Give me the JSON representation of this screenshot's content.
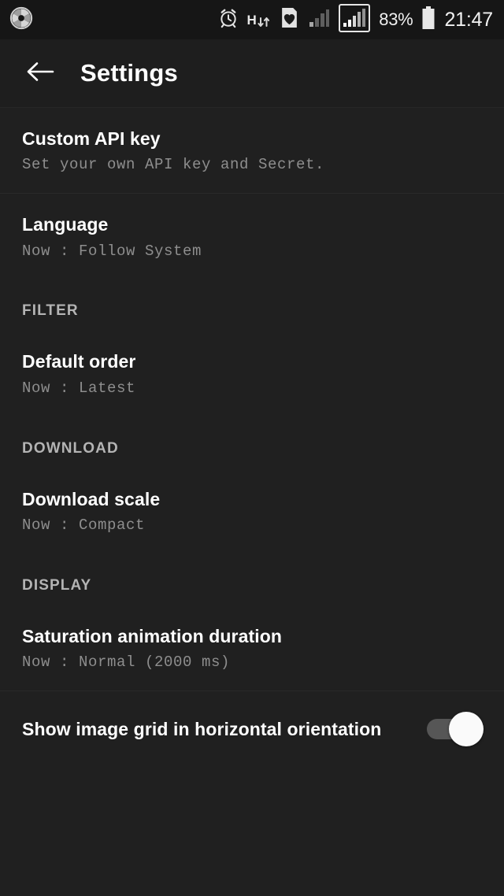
{
  "status_bar": {
    "app_icon": "camera-aperture-icon",
    "icons": [
      "alarm-clock-icon",
      "hspa-data-icon",
      "heart-card-icon",
      "signal-bars-dim-icon",
      "signal-bars-boxed-icon"
    ],
    "hspa_label": "H",
    "battery_percent": "83%",
    "battery_icon": "battery-icon",
    "clock": "21:47"
  },
  "toolbar": {
    "back_icon": "arrow-back-icon",
    "title": "Settings"
  },
  "settings": {
    "items": [
      {
        "type": "preference",
        "name": "custom-api-key",
        "title": "Custom API key",
        "summary": "Set your own API key and Secret."
      },
      {
        "type": "preference",
        "name": "language",
        "title": "Language",
        "summary": "Now : Follow System"
      },
      {
        "type": "section",
        "name": "filter",
        "title": "FILTER"
      },
      {
        "type": "preference",
        "name": "default-order",
        "title": "Default order",
        "summary": "Now : Latest"
      },
      {
        "type": "section",
        "name": "download",
        "title": "DOWNLOAD"
      },
      {
        "type": "preference",
        "name": "download-scale",
        "title": "Download scale",
        "summary": "Now : Compact"
      },
      {
        "type": "section",
        "name": "display",
        "title": "DISPLAY"
      },
      {
        "type": "preference",
        "name": "saturation-animation-duration",
        "title": "Saturation animation duration",
        "summary": "Now : Normal (2000 ms)"
      },
      {
        "type": "switch",
        "name": "show-image-grid-horizontal",
        "title": "Show image grid in horizontal orientation",
        "checked": true
      }
    ]
  },
  "colors": {
    "background": "#202020",
    "status_bar_background": "#161616",
    "toolbar_background": "#1e1e1e",
    "title_text": "#ffffff",
    "summary_text": "#8e8e8e",
    "section_text": "#b4b4b4",
    "divider": "#2a2a2a",
    "switch_thumb": "#fafafa",
    "switch_track": "#565656"
  }
}
